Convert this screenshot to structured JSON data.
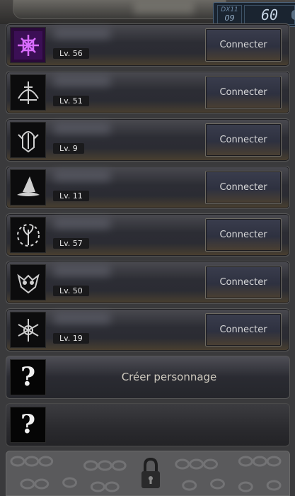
{
  "overlay": {
    "api": "DX11",
    "api_sub": "09",
    "fps": "60"
  },
  "characters": [
    {
      "level": "Lv. 56",
      "button": "Connecter",
      "icon": "purple-rune-icon"
    },
    {
      "level": "Lv. 51",
      "button": "Connecter",
      "icon": "crossbow-icon"
    },
    {
      "level": "Lv. 9",
      "button": "Connecter",
      "icon": "warrior-helm-icon"
    },
    {
      "level": "Lv. 11",
      "button": "Connecter",
      "icon": "wizard-hat-icon"
    },
    {
      "level": "Lv. 57",
      "button": "Connecter",
      "icon": "flower-branch-icon"
    },
    {
      "level": "Lv. 50",
      "button": "Connecter",
      "icon": "dragon-mask-icon"
    },
    {
      "level": "Lv. 19",
      "button": "Connecter",
      "icon": "spiked-sigil-icon"
    }
  ],
  "create": {
    "label": "Créer personnage",
    "icon": "question-mark-icon",
    "glyph": "?"
  },
  "empty_slot": {
    "icon": "question-mark-icon",
    "glyph": "?"
  },
  "locked_slot": {
    "icon": "padlock-icon"
  }
}
